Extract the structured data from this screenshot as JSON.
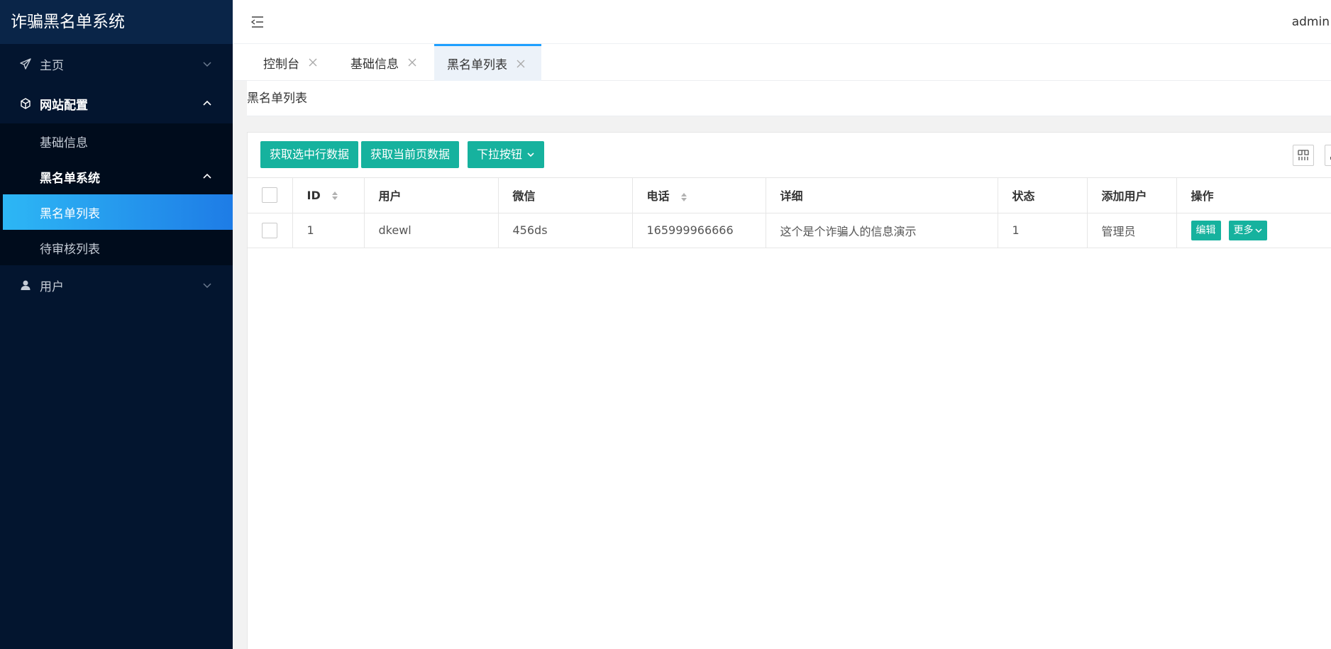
{
  "app": {
    "title": "诈骗黑名单系统"
  },
  "header": {
    "user": "admin"
  },
  "sidebar": {
    "items": [
      {
        "label": "主页",
        "icon": "paper-plane-icon"
      },
      {
        "label": "网站配置",
        "icon": "cube-icon",
        "children": [
          {
            "label": "基础信息"
          },
          {
            "label": "黑名单系统",
            "children": [
              {
                "label": "黑名单列表"
              },
              {
                "label": "待审核列表"
              }
            ]
          }
        ]
      },
      {
        "label": "用户",
        "icon": "user-icon"
      }
    ]
  },
  "tabs": [
    {
      "label": "控制台"
    },
    {
      "label": "基础信息"
    },
    {
      "label": "黑名单列表"
    }
  ],
  "page": {
    "title": "黑名单列表"
  },
  "toolbar": {
    "buttons": [
      "获取选中行数据",
      "获取当前页数据",
      "下拉按钮"
    ],
    "tools": [
      "columns-filter-icon",
      "export-icon",
      "print-icon",
      "info-icon"
    ]
  },
  "table": {
    "columns": [
      "ID",
      "用户",
      "微信",
      "电话",
      "详细",
      "状态",
      "添加用户",
      "操作"
    ],
    "rows": [
      {
        "id": "1",
        "user": "dkewl",
        "wechat": "456ds",
        "phone": "165999966666",
        "detail": "这个是个诈骗人的信息演示",
        "status": "1",
        "added_by": "管理员",
        "actions": [
          "编辑",
          "更多"
        ]
      }
    ]
  },
  "colors": {
    "sidebar": "#03152f",
    "accent": "#16b29e",
    "active": "#1e7ce6",
    "tab_active_border": "#1e9fff"
  }
}
